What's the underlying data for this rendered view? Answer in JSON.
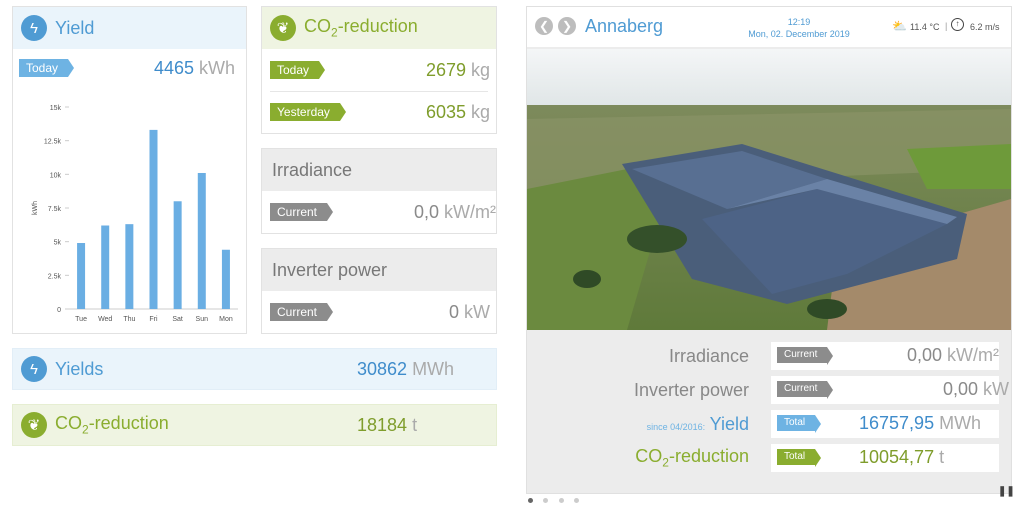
{
  "yield_card": {
    "title": "Yield",
    "today_label": "Today",
    "today_value": "4465",
    "today_unit": "kWh"
  },
  "chart_data": {
    "type": "bar",
    "categories": [
      "Tue",
      "Wed",
      "Thu",
      "Fri",
      "Sat",
      "Sun",
      "Mon"
    ],
    "values": [
      4900,
      6200,
      6300,
      13300,
      8000,
      10100,
      4400
    ],
    "ylabel": "kWh",
    "ylim": [
      0,
      15000
    ],
    "yticks": [
      "0",
      "2.5k",
      "5k",
      "7.5k",
      "10k",
      "12.5k",
      "15k"
    ],
    "color": "#6aaee3"
  },
  "co2_card": {
    "title_prefix": "CO",
    "title_sub": "2",
    "title_suffix": "-reduction",
    "today_label": "Today",
    "today_value": "2679",
    "today_unit": "kg",
    "yesterday_label": "Yesterday",
    "yesterday_value": "6035",
    "yesterday_unit": "kg"
  },
  "irradiance_card": {
    "title": "Irradiance",
    "label": "Current",
    "value": "0,0",
    "unit": "kW/m²"
  },
  "inverter_card": {
    "title": "Inverter power",
    "label": "Current",
    "value": "0",
    "unit": "kW"
  },
  "yields_total": {
    "title": "Yields",
    "value": "30862",
    "unit": "MWh"
  },
  "co2_total": {
    "title_prefix": "CO",
    "title_sub": "2",
    "title_suffix": "-reduction",
    "value": "18184",
    "unit": "t"
  },
  "plant": {
    "name": "Annaberg",
    "time": "12:19",
    "date": "Mon, 02. December 2019",
    "temperature": "11.4 °C",
    "wind": "6.2",
    "wind_unit": "m/s",
    "irradiance": {
      "label": "Irradiance",
      "tag": "Current",
      "value": "0,00",
      "unit": "kW/m²"
    },
    "inverter": {
      "label": "Inverter power",
      "tag": "Current",
      "value": "0,00",
      "unit": "kW"
    },
    "yield": {
      "since": "since 04/2016:",
      "label": "Yield",
      "tag": "Total",
      "value": "16757,95",
      "unit": "MWh"
    },
    "co2": {
      "label_prefix": "CO",
      "label_sub": "2",
      "label_suffix": "-reduction",
      "tag": "Total",
      "value": "10054,77",
      "unit": "t"
    }
  },
  "colors": {
    "blue": "#4f9bd3",
    "green": "#8aad2f",
    "gray": "#8c8c8c"
  }
}
